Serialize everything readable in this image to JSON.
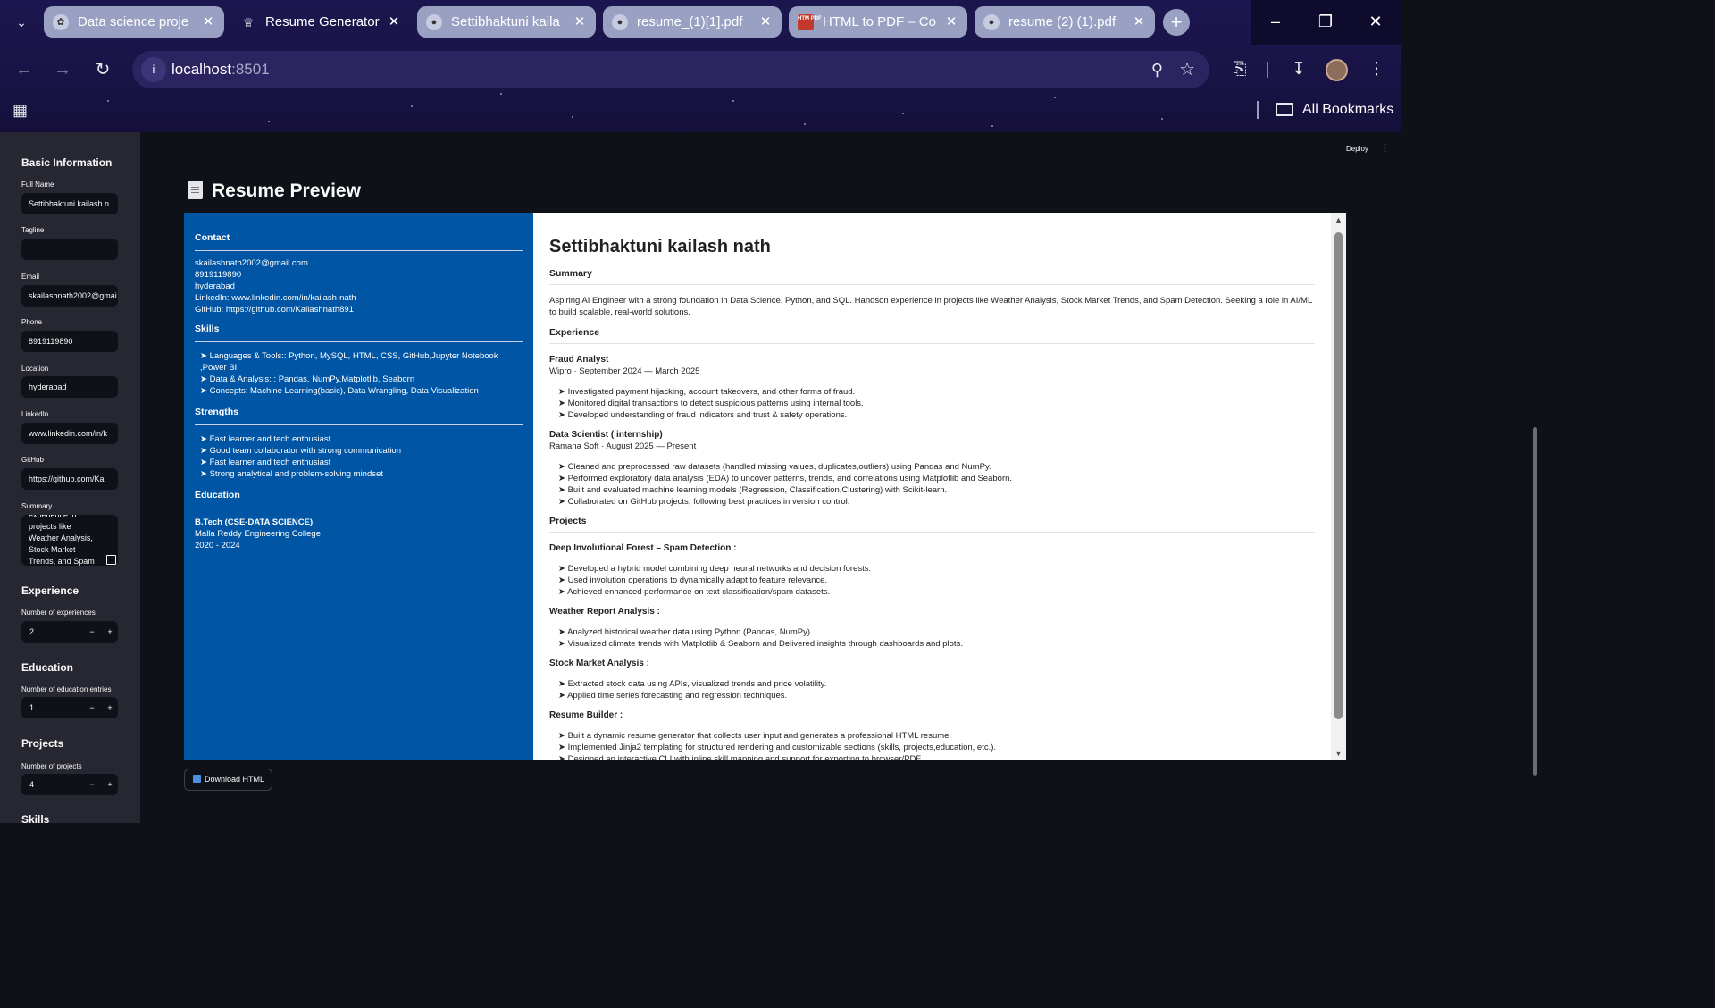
{
  "browser": {
    "tabs": [
      {
        "title": "Data science proje",
        "icon": "openai-icon"
      },
      {
        "title": "Resume Generator",
        "icon": "streamlit-crown-icon"
      },
      {
        "title": "Settibhaktuni kaila",
        "icon": "globe-icon"
      },
      {
        "title": "resume_(1)[1].pdf",
        "icon": "globe-icon"
      },
      {
        "title": "HTML to PDF – Co",
        "icon": "htmlpdf-icon",
        "icon_text": "HTM PDF"
      },
      {
        "title": "resume (2) (1).pdf",
        "icon": "globe-icon"
      }
    ],
    "url_host": "localhost",
    "url_port": ":8501",
    "bookmarks_label": "All Bookmarks"
  },
  "sidebar": {
    "basic_heading": "Basic Information",
    "fields": {
      "full_name": {
        "label": "Full Name",
        "value": "Settibhaktuni kailash n"
      },
      "tagline": {
        "label": "Tagline",
        "value": ""
      },
      "email": {
        "label": "Email",
        "value": "skailashnath2002@gmai"
      },
      "phone": {
        "label": "Phone",
        "value": "8919119890"
      },
      "location": {
        "label": "Location",
        "value": "hyderabad"
      },
      "linkedin": {
        "label": "LinkedIn",
        "value": "www.linkedin.com/in/k"
      },
      "github": {
        "label": "GitHub",
        "value": "https://github.com/Kai"
      },
      "summary": {
        "label": "Summary",
        "value": "experience in projects like Weather Analysis, Stock Market Trends, and Spam"
      }
    },
    "experience": {
      "heading": "Experience",
      "label": "Number of experiences",
      "value": "2"
    },
    "education": {
      "heading": "Education",
      "label": "Number of education entries",
      "value": "1"
    },
    "projects": {
      "heading": "Projects",
      "label": "Number of projects",
      "value": "4"
    },
    "skills_heading": "Skills",
    "minus": "−",
    "plus": "+"
  },
  "main": {
    "deploy_label": "Deploy",
    "preview_title": "Resume Preview",
    "download_label": "Download HTML"
  },
  "resume": {
    "name": "Settibhaktuni kailash nath",
    "contact_heading": "Contact",
    "contact": [
      "skailashnath2002@gmail.com",
      "8919119890",
      "hyderabad",
      "LinkedIn: www.linkedin.com/in/kailash-nath",
      "GitHub: https://github.com/Kailashnath891"
    ],
    "skills_heading": "Skills",
    "skills": [
      "➤ Languages & Tools:: Python, MySQL, HTML, CSS, GitHub,Jupyter Notebook ,Power BI",
      "➤ Data & Analysis: : Pandas, NumPy,Matplotlib, Seaborn",
      "➤ Concepts: Machine Learning(basic), Data Wrangling, Data Visualization"
    ],
    "strengths_heading": "Strengths",
    "strengths": [
      "➤ Fast learner and tech enthusiast",
      "➤ Good team collaborator with strong communication",
      "➤ Fast learner and tech enthusiast",
      "➤ Strong analytical and problem-solving mindset"
    ],
    "education_heading": "Education",
    "education": {
      "degree": "B.Tech (CSE-DATA SCIENCE)",
      "college": "Malla Reddy Engineering College",
      "years": "2020 - 2024"
    },
    "summary_heading": "Summary",
    "summary": "Aspiring AI Engineer with a strong foundation in Data Science, Python, and SQL. Handson experience in projects like Weather Analysis, Stock Market Trends, and Spam Detection. Seeking a role in AI/ML to build scalable, real-world solutions.",
    "experience_heading": "Experience",
    "experience": [
      {
        "title": "Fraud Analyst",
        "meta": "Wipro · September 2024 — March 2025",
        "bullets": [
          "➤ Investigated payment hijacking, account takeovers, and other forms of fraud.",
          "➤ Monitored digital transactions to detect suspicious patterns using internal tools.",
          "➤ Developed understanding of fraud indicators and trust & safety operations."
        ]
      },
      {
        "title": "Data Scientist ( internship)",
        "meta": "Ramana Soft · August 2025 — Present",
        "bullets": [
          "➤ Cleaned and preprocessed raw datasets (handled missing values, duplicates,outliers) using Pandas and NumPy.",
          "➤ Performed exploratory data analysis (EDA) to uncover patterns, trends, and correlations using Matplotlib and Seaborn.",
          "➤ Built and evaluated machine learning models (Regression, Classification,Clustering) with Scikit-learn.",
          "➤ Collaborated on GitHub projects, following best practices in version control."
        ]
      }
    ],
    "projects_heading": "Projects",
    "projects": [
      {
        "title": "Deep Involutional Forest – Spam Detection :",
        "bullets": [
          "➤ Developed a hybrid model combining deep neural networks and decision forests.",
          "➤ Used involution operations to dynamically adapt to feature relevance.",
          "➤ Achieved enhanced performance on text classification/spam datasets."
        ]
      },
      {
        "title": "Weather Report Analysis :",
        "bullets": [
          "➤ Analyzed historical weather data using Python (Pandas, NumPy).",
          "➤ Visualized climate trends with Matplotlib & Seaborn and Delivered insights through dashboards and plots."
        ]
      },
      {
        "title": "Stock Market Analysis :",
        "bullets": [
          "➤ Extracted stock data using APIs, visualized trends and price volatility.",
          "➤ Applied time series forecasting and regression techniques."
        ]
      },
      {
        "title": "Resume Builder :",
        "bullets": [
          "➤ Built a dynamic resume generator that collects user input and generates a professional HTML resume.",
          "➤ Implemented Jinja2 templating for structured rendering and customizable sections (skills, projects,education, etc.).",
          "➤ Designed an interactive CLI with inline skill mapping and support for exporting to browser/PDF."
        ]
      }
    ]
  }
}
